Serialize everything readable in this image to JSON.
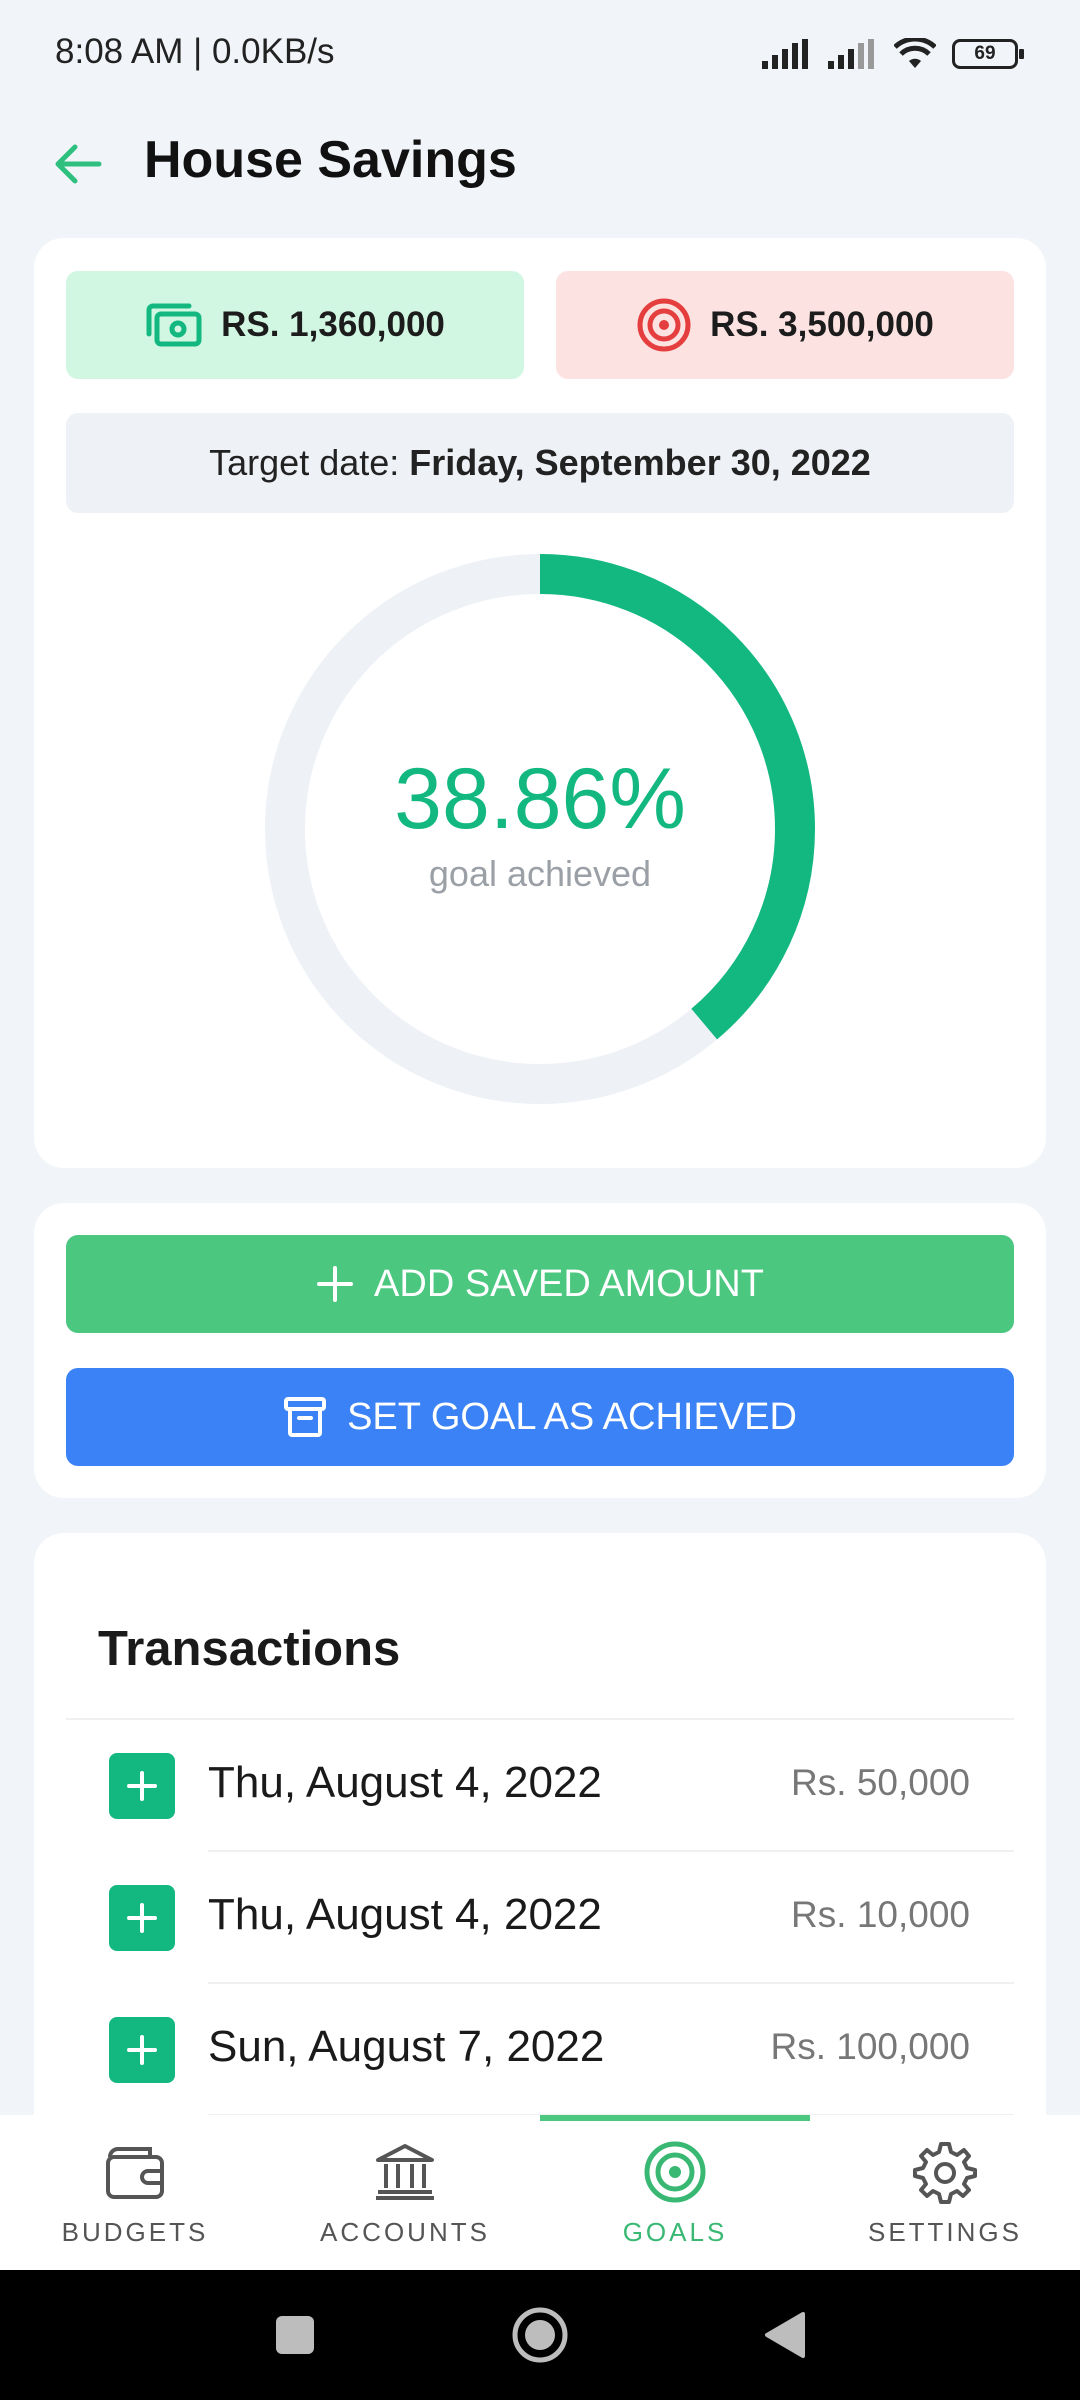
{
  "status_bar": {
    "time": "8:08 AM | 0.0KB/s",
    "battery": "69"
  },
  "header": {
    "title": "House Savings"
  },
  "summary": {
    "saved_amount": "RS. 1,360,000",
    "target_amount": "RS. 3,500,000",
    "target_date_label": "Target date:",
    "target_date": "Friday, September 30, 2022",
    "progress_percent_text": "38.86%",
    "progress_fraction": 0.3886,
    "progress_label": "goal achieved"
  },
  "actions": {
    "add_label": "ADD SAVED AMOUNT",
    "achieved_label": "SET GOAL AS ACHIEVED"
  },
  "transactions": {
    "title": "Transactions",
    "items": [
      {
        "date": "Thu, August 4, 2022",
        "amount": "Rs. 50,000"
      },
      {
        "date": "Thu, August 4, 2022",
        "amount": "Rs. 10,000"
      },
      {
        "date": "Sun, August 7, 2022",
        "amount": "Rs. 100,000"
      }
    ]
  },
  "bottom_nav": {
    "items": [
      {
        "label": "BUDGETS",
        "icon": "wallet-icon"
      },
      {
        "label": "ACCOUNTS",
        "icon": "bank-icon"
      },
      {
        "label": "GOALS",
        "icon": "target-icon",
        "active": true
      },
      {
        "label": "SETTINGS",
        "icon": "gear-icon"
      }
    ]
  },
  "colors": {
    "accent_green": "#12b880",
    "button_green": "#4cc77f",
    "button_blue": "#3b82f6",
    "saved_bg": "#d1f7e3",
    "target_bg": "#fde2e2",
    "target_red": "#e53e3e"
  }
}
